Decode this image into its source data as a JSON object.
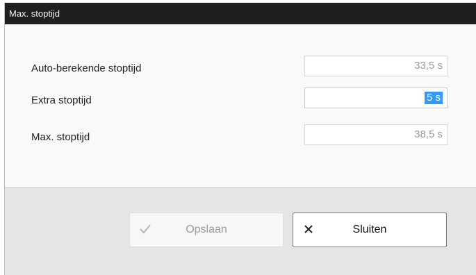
{
  "dialog": {
    "title": "Max. stoptijd"
  },
  "fields": [
    {
      "label": "Auto-berekende stoptijd",
      "value": "33,5 s",
      "editable": false
    },
    {
      "label": "Extra stoptijd",
      "value_number": "5",
      "value_unit": "s",
      "editable": true,
      "selected": true
    },
    {
      "label": "Max. stoptijd",
      "value": "38,5 s",
      "editable": false
    }
  ],
  "buttons": {
    "save": {
      "label": "Opslaan",
      "icon": "checkmark-icon",
      "enabled": false
    },
    "close": {
      "label": "Sluiten",
      "icon": "close-icon",
      "enabled": true
    }
  },
  "colors": {
    "titlebar": "#1f1f1f",
    "selection": "#3399ff",
    "footer": "#e6e6e6"
  }
}
